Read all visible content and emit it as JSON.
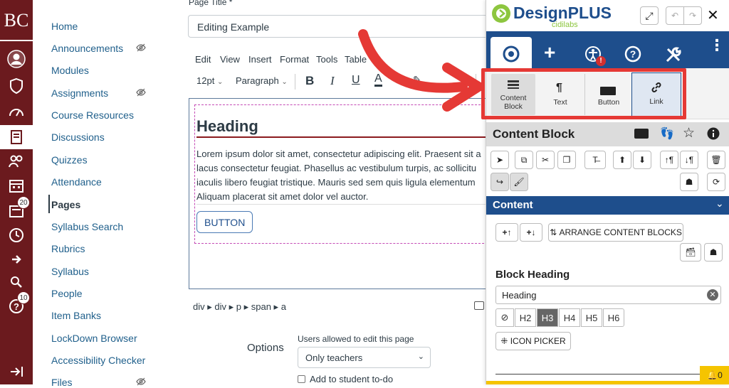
{
  "global_nav": {
    "logo": "BC",
    "inbox_badge": "20",
    "help_badge": "10"
  },
  "course_nav": {
    "items": [
      "Home",
      "Announcements",
      "Modules",
      "Assignments",
      "Course Resources",
      "Discussions",
      "Quizzes",
      "Attendance",
      "Pages",
      "Syllabus Search",
      "Rubrics",
      "Syllabus",
      "People",
      "Item Banks",
      "LockDown Browser",
      "Accessibility Checker",
      "Files"
    ],
    "active": "Pages"
  },
  "page": {
    "title_label": "Page Title *",
    "title_value": "Editing Example",
    "menubar": [
      "Edit",
      "View",
      "Insert",
      "Format",
      "Tools",
      "Table"
    ],
    "font_size": "12pt",
    "block_format": "Paragraph",
    "heading": "Heading",
    "body_text_lines": [
      "Lorem ipsum dolor sit amet, consectetur adipiscing elit. Praesent sit a",
      "lacus consectetur feugiat. Phasellus ac vestibulum turpis, ac sollicitu",
      "iaculis libero feugiat tristique. Mauris sed sem quis ligula elementum",
      "Aliquam placerat sit amet dolor vel auctor."
    ],
    "button_text": "BUTTON",
    "path": [
      "div",
      "div",
      "p",
      "span",
      "a"
    ],
    "options_label": "Options",
    "edit_perm_label": "Users allowed to edit this page",
    "edit_perm_value": "Only teachers",
    "todo_label": "Add to student to-do"
  },
  "designplus": {
    "brand": "DesignPLUS",
    "brand_sub": "cidilabs",
    "insert_options": [
      {
        "icon": "content-block-icon",
        "label": "Content\nBlock"
      },
      {
        "icon": "paragraph-icon",
        "label": "Text"
      },
      {
        "icon": "button-shape-icon",
        "label": "Button"
      },
      {
        "icon": "link-icon",
        "label": "Link"
      }
    ],
    "section_title": "Content Block",
    "content_header": "Content",
    "arrange_label": "ARRANGE CONTENT BLOCKS",
    "block_heading_label": "Block Heading",
    "block_heading_value": "Heading",
    "heading_levels": [
      "H2",
      "H3",
      "H4",
      "H5",
      "H6"
    ],
    "selected_heading": "H3",
    "icon_picker_label": "ICON PICKER",
    "alert_count": "0",
    "colors": {
      "brand_blue": "#1e4e8c",
      "accent_red": "#e53935",
      "accent_yellow": "#f5c400",
      "nav_maroon": "#6b1a1e"
    }
  }
}
